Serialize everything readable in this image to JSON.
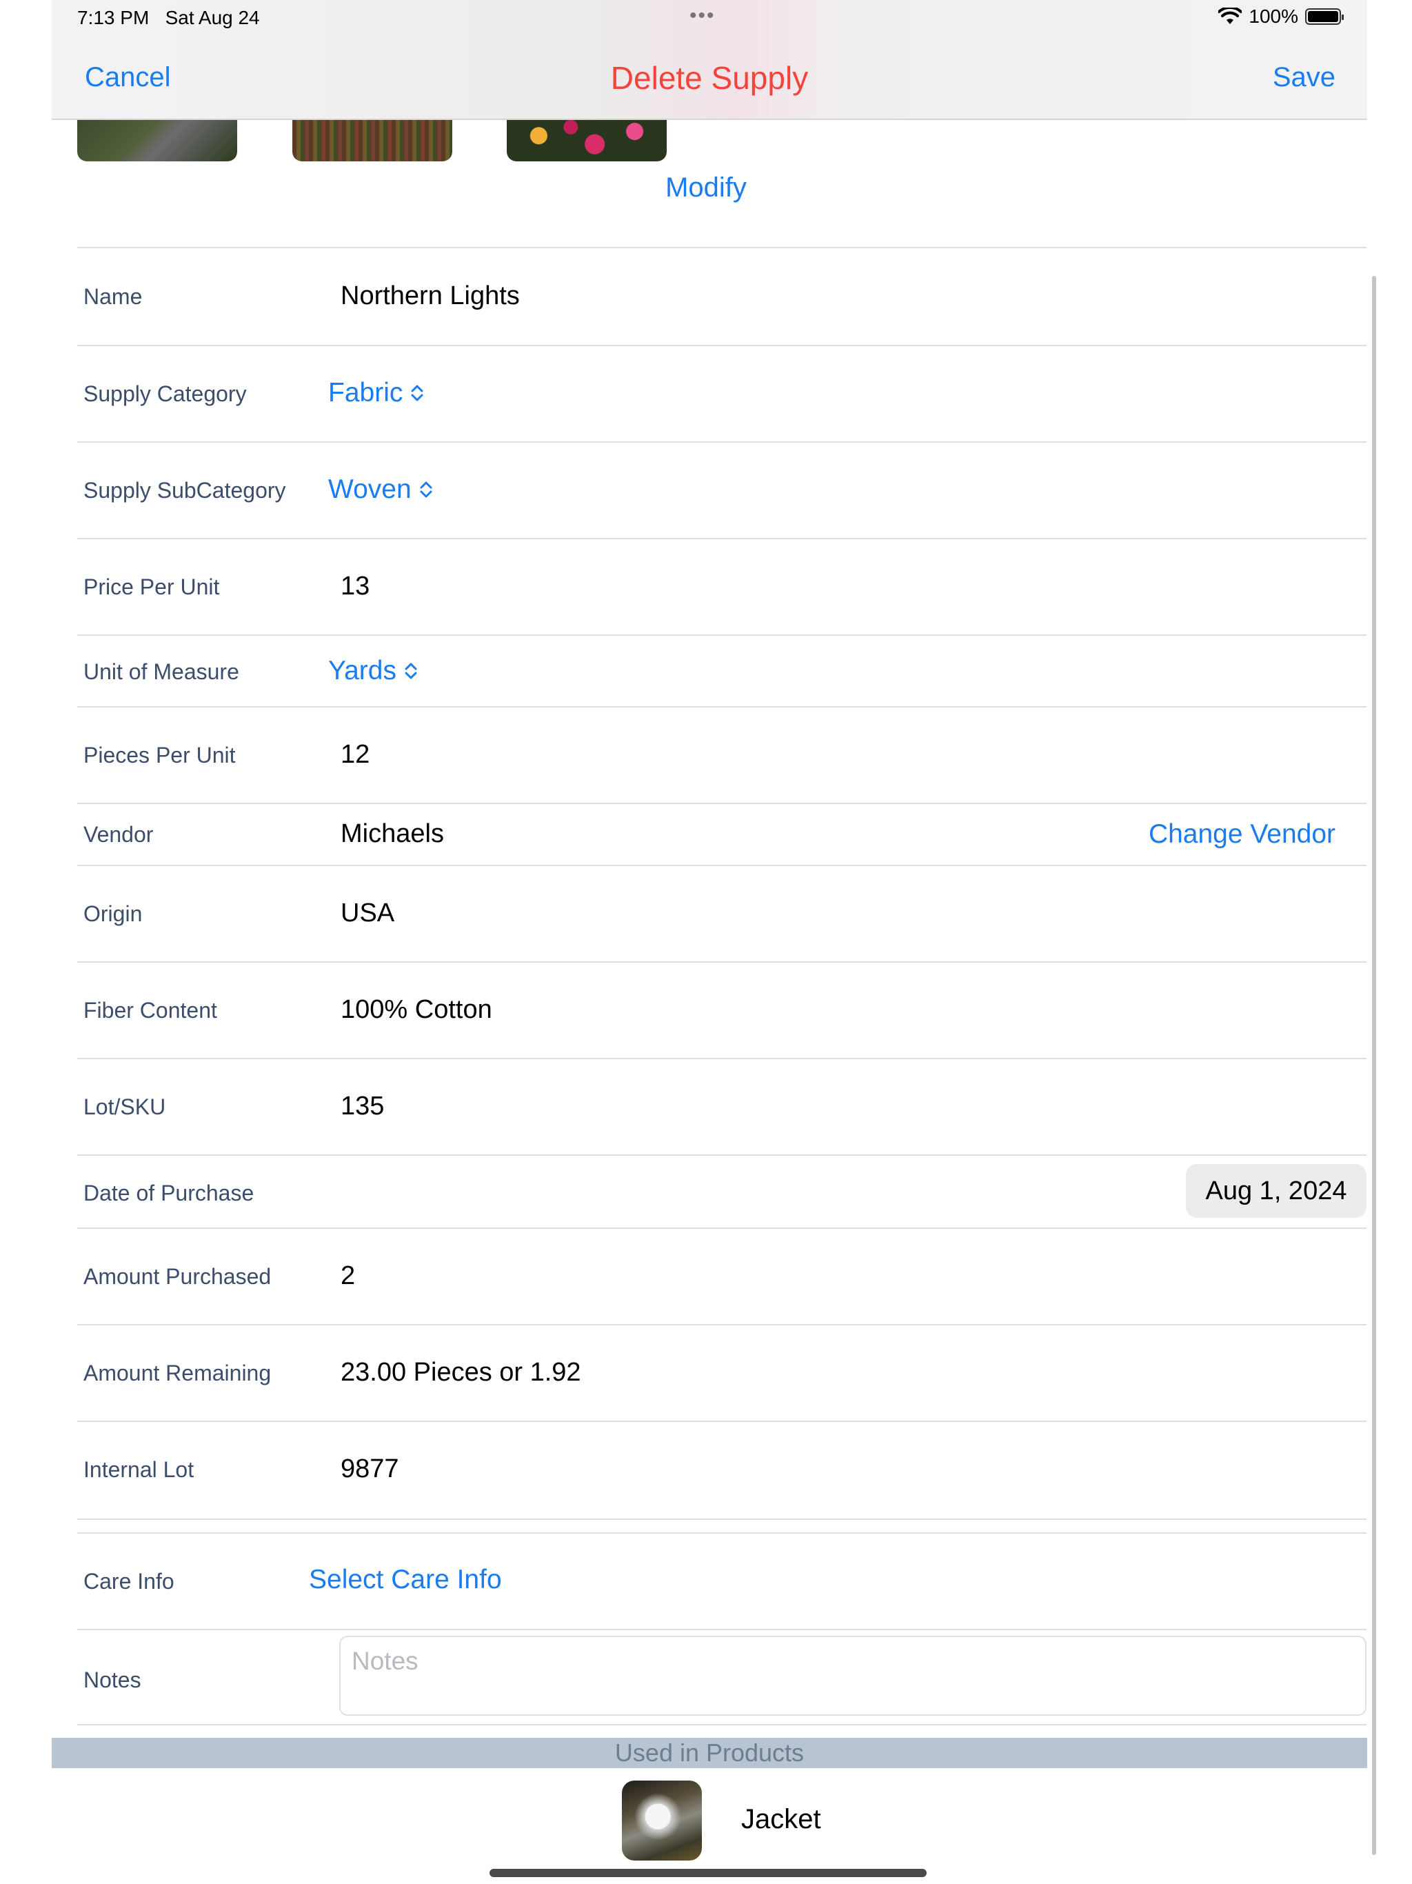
{
  "status_bar": {
    "time": "7:13 PM",
    "date": "Sat Aug 24",
    "dots": "•••",
    "battery": "100%"
  },
  "nav": {
    "cancel_label": "Cancel",
    "title": "Delete Supply",
    "save_label": "Save"
  },
  "photos": {
    "modify_label": "Modify"
  },
  "form": {
    "name": {
      "label": "Name",
      "value": "Northern Lights"
    },
    "supply_category": {
      "label": "Supply Category",
      "value": "Fabric"
    },
    "supply_subcategory": {
      "label": "Supply SubCategory",
      "value": "Woven"
    },
    "price_per_unit": {
      "label": "Price Per Unit",
      "value": "13"
    },
    "unit_of_measure": {
      "label": "Unit of Measure",
      "value": "Yards"
    },
    "pieces_per_unit": {
      "label": "Pieces Per Unit",
      "value": "12"
    },
    "vendor": {
      "label": "Vendor",
      "value": "Michaels",
      "change_label": "Change Vendor"
    },
    "origin": {
      "label": "Origin",
      "value": "USA"
    },
    "fiber_content": {
      "label": "Fiber Content",
      "value": "100% Cotton"
    },
    "lot_sku": {
      "label": "Lot/SKU",
      "value": "135"
    },
    "date_of_purchase": {
      "label": "Date of Purchase",
      "value": "Aug 1, 2024"
    },
    "amount_purchased": {
      "label": "Amount Purchased",
      "value": "2"
    },
    "amount_remaining": {
      "label": "Amount Remaining",
      "value": "23.00 Pieces or 1.92"
    },
    "internal_lot": {
      "label": "Internal Lot",
      "value": "9877"
    },
    "care_info": {
      "label": "Care Info",
      "value": "Select Care Info"
    },
    "notes": {
      "label": "Notes",
      "placeholder": "Notes"
    }
  },
  "used_in_products": {
    "header": "Used in Products",
    "items": [
      {
        "name": "Jacket"
      }
    ]
  },
  "colors": {
    "accent": "#1a7cf0",
    "destructive": "#f2443a",
    "label": "#3c4d6a",
    "section_header": "#b8c4d2"
  },
  "icons": {
    "wifi": "wifi-icon",
    "battery": "battery-icon",
    "chevron": "up-down-chevron-icon"
  }
}
